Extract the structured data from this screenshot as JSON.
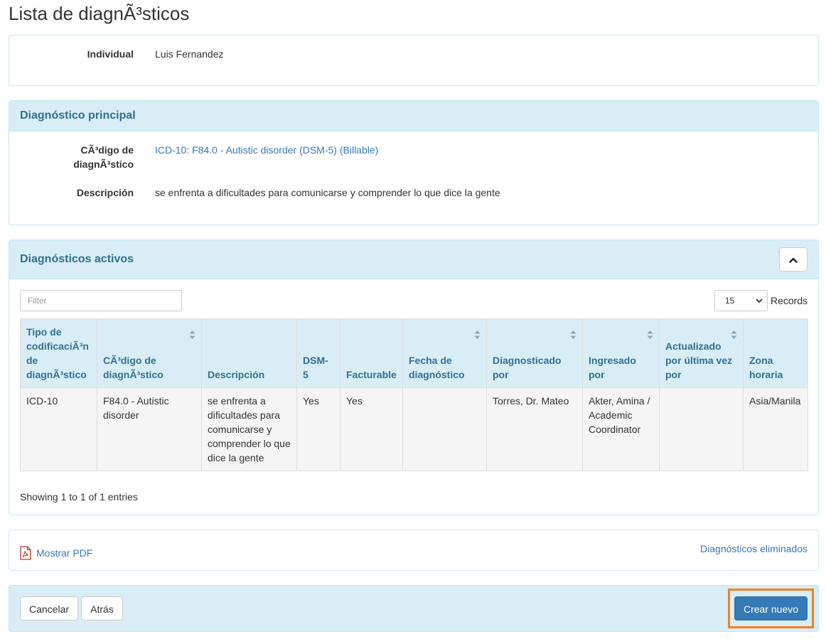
{
  "page": {
    "title": "Lista de diagnÃ³sticos"
  },
  "individual": {
    "label": "Individual",
    "value": "Luis Fernandez"
  },
  "principal": {
    "heading": "Diagnóstico principal",
    "code_label_line1": "CÃ³digo de",
    "code_label_line2": "diagnÃ³stico",
    "code_value": "ICD-10: F84.0 - Autistic disorder (DSM-5) (Billable)",
    "desc_label": "Descripción",
    "desc_value": "se enfrenta a dificultades para comunicarse y comprender lo que dice la gente"
  },
  "activos": {
    "heading": "Diagnósticos activos",
    "filter_placeholder": "Filter",
    "records_value": "15",
    "records_label": "Records",
    "columns": [
      "Tipo de codificaciÃ³n de diagnÃ³stico",
      "CÃ³digo de diagnÃ³stico",
      "Descripción",
      "DSM-5",
      "Facturable",
      "Fecha de diagnóstico",
      "Diagnosticado por",
      "Ingresado por",
      "Actualizado por última vez por",
      "Zona horaria"
    ],
    "rows": [
      [
        "ICD-10",
        "F84.0 - Autistic disorder",
        "se enfrenta a dificultades para comunicarse y comprender lo que dice la gente",
        "Yes",
        "Yes",
        "",
        "Torres, Dr. Mateo",
        "Akter, Amina / Academic Coordinator",
        "",
        "Asia/Manila"
      ]
    ],
    "showing": "Showing 1 to 1 of 1 entries"
  },
  "links": {
    "pdf": "Mostrar PDF",
    "deleted": "Diagnósticos eliminados"
  },
  "footer": {
    "cancel": "Cancelar",
    "back": "Atrás",
    "create": "Crear nuevo"
  },
  "colors": {
    "panel_heading_bg": "#d9edf7",
    "panel_heading_text": "#31708f",
    "link": "#337ab7",
    "primary": "#337ab7",
    "highlight": "#f0801f"
  }
}
